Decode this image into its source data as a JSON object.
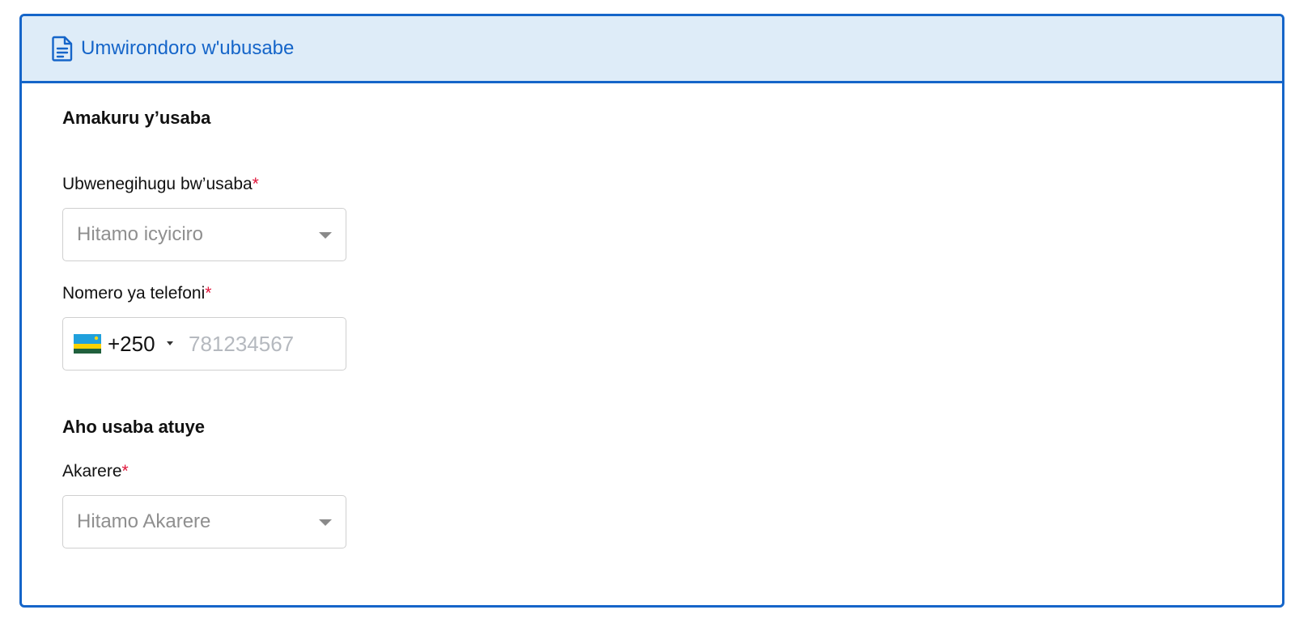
{
  "header": {
    "icon": "document-icon",
    "title": "Umwirondoro w'ubusabe"
  },
  "applicant_section": {
    "title": "Amakuru y’usaba",
    "nationality": {
      "label": "Ubwenegihugu bw’usaba",
      "required_mark": "*",
      "placeholder": "Hitamo icyiciro"
    },
    "phone": {
      "label": "Nomero ya telefoni",
      "required_mark": "*",
      "country_flag": "rwanda-flag-icon",
      "dial_code": "+250",
      "placeholder": "781234567",
      "value": ""
    }
  },
  "residence_section": {
    "title": "Aho usaba atuye",
    "district": {
      "label": "Akarere",
      "required_mark": "*",
      "placeholder": "Hitamo Akarere"
    }
  },
  "colors": {
    "accent": "#1565c9",
    "header_bg": "#deecf8",
    "required": "#e0153a",
    "placeholder": "#8f8f8f"
  }
}
